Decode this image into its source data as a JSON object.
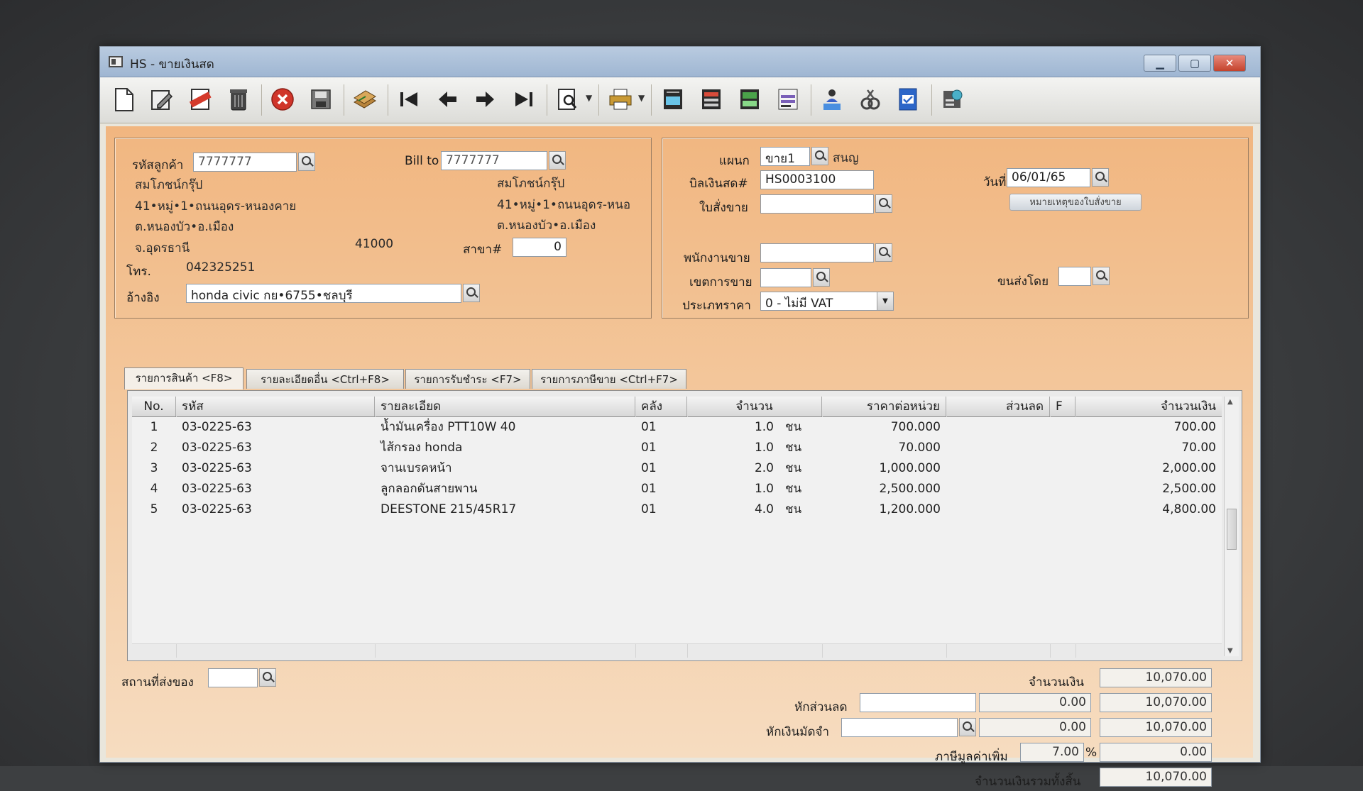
{
  "window": {
    "title": "HS - ขายเงินสด"
  },
  "toolbar": {
    "icons": [
      "new-document-icon",
      "edit-icon",
      "void-icon",
      "delete-bin-icon",
      "cancel-icon",
      "save-icon",
      "stack-icon",
      "first-record-icon",
      "previous-record-icon",
      "next-record-icon",
      "last-record-icon",
      "search-document-icon",
      "print-icon",
      "form-icon",
      "calculator-icon",
      "tax-icon",
      "report-icon",
      "user-approve-icon",
      "tools-icon",
      "ok-document-icon",
      "settings-icon"
    ]
  },
  "customer": {
    "code_label": "รหัสลูกค้า",
    "code_value": "7777777",
    "name": "สมโภชน์กรุ๊ป",
    "addr1": "41•หมู่•1•ถนนอุดร-หนองคาย",
    "addr2": "ต.หนองบัว•อ.เมือง",
    "addr3": "จ.อุดรธานี",
    "postcode": "41000",
    "phone_label": "โทร.",
    "phone": "042325251",
    "ref_label": "อ้างอิง",
    "ref_value": "honda civic กย•6755•ชลบุรี"
  },
  "billto": {
    "label": "Bill to",
    "value": "7777777",
    "name": "สมโภชน์กรุ๊ป",
    "addr1": "41•หมู่•1•ถนนอุดร-หนอ",
    "addr2": "ต.หนองบัว•อ.เมือง",
    "branch_label": "สาขา#",
    "branch_value": "0"
  },
  "doc": {
    "dept_label": "แผนก",
    "dept_value": "ขาย1",
    "dept_name": "สนญ",
    "bill_label": "บิลเงินสด#",
    "bill_value": "HS0003100",
    "order_label": "ใบสั่งขาย",
    "order_value": "",
    "date_label": "วันที่",
    "date_value": "06/01/65",
    "order_note_button": "หมายเหตุของใบสั่งขาย",
    "salesman_label": "พนักงานขาย",
    "salesman_value": "",
    "area_label": "เขตการขาย",
    "area_value": "",
    "ship_label": "ขนส่งโดย",
    "ship_value": "",
    "price_type_label": "ประเภทราคา",
    "price_type_value": "0 - ไม่มี VAT"
  },
  "tabs": [
    {
      "label": "รายการสินค้า <F8>"
    },
    {
      "label": "รายละเอียดอื่น <Ctrl+F8>"
    },
    {
      "label": "รายการรับชำระ <F7>"
    },
    {
      "label": "รายการภาษีขาย <Ctrl+F7>"
    }
  ],
  "grid": {
    "headers": {
      "no": "No.",
      "code": "รหัส",
      "desc": "รายละเอียด",
      "wh": "คลัง",
      "qty": "จำนวน",
      "price": "ราคาต่อหน่วย",
      "disc": "ส่วนลด",
      "f": "F",
      "amount": "จำนวนเงิน"
    },
    "rows": [
      {
        "no": "1",
        "code": "03-0225-63",
        "desc": "น้ำมันเครื่อง PTT10W 40",
        "wh": "01",
        "qty": "1.0",
        "unit": "ชน",
        "price": "700.000",
        "disc": "",
        "f": "",
        "amount": "700.00"
      },
      {
        "no": "2",
        "code": "03-0225-63",
        "desc": "ไส้กรอง honda",
        "wh": "01",
        "qty": "1.0",
        "unit": "ชน",
        "price": "70.000",
        "disc": "",
        "f": "",
        "amount": "70.00"
      },
      {
        "no": "3",
        "code": "03-0225-63",
        "desc": "จานเบรคหน้า",
        "wh": "01",
        "qty": "2.0",
        "unit": "ชน",
        "price": "1,000.000",
        "disc": "",
        "f": "",
        "amount": "2,000.00"
      },
      {
        "no": "4",
        "code": "03-0225-63",
        "desc": "ลูกลอกดันสายพาน",
        "wh": "01",
        "qty": "1.0",
        "unit": "ชน",
        "price": "2,500.000",
        "disc": "",
        "f": "",
        "amount": "2,500.00"
      },
      {
        "no": "5",
        "code": "03-0225-63",
        "desc": "DEESTONE 215/45R17",
        "wh": "01",
        "qty": "4.0",
        "unit": "ชน",
        "price": "1,200.000",
        "disc": "",
        "f": "",
        "amount": "4,800.00"
      }
    ]
  },
  "footer": {
    "ship_place_label": "สถานที่ส่งของ",
    "ship_place_value": "",
    "amount_label": "จำนวนเงิน",
    "amount_value": "10,070.00",
    "discount_label": "หักส่วนลด",
    "discount_text": "",
    "discount_value": "0.00",
    "after_discount": "10,070.00",
    "deposit_label": "หักเงินมัดจำ",
    "deposit_text": "",
    "deposit_value": "0.00",
    "after_deposit": "10,070.00",
    "vat_label": "ภาษีมูลค่าเพิ่ม",
    "vat_rate": "7.00",
    "vat_pct": "%",
    "vat_value": "0.00",
    "total_label": "จำนวนเงินรวมทั้งสิ้น",
    "total_value": "10,070.00"
  }
}
